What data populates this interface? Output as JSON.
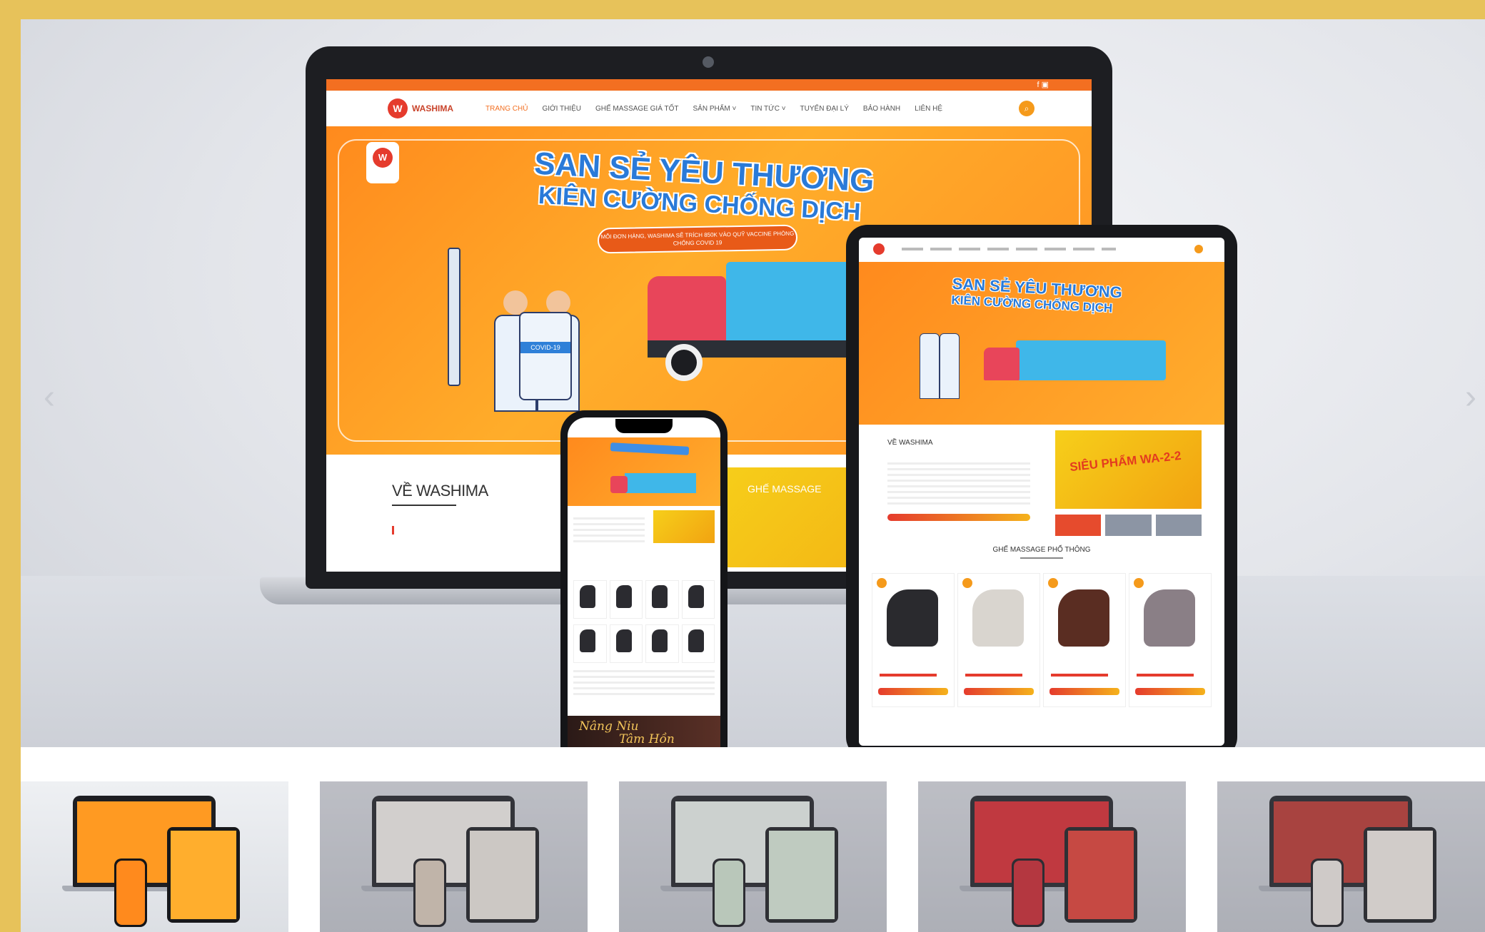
{
  "gallery": {
    "prev_icon": "‹",
    "next_icon": "›"
  },
  "laptop_site": {
    "logo_text": "WASHIMA",
    "logo_mark": "W",
    "social_icons": "f ▣",
    "nav": [
      "TRANG CHỦ",
      "GIỚI THIỆU",
      "GHẾ MASSAGE GIÁ TỐT",
      "SẢN PHẨM ˅",
      "TIN TỨC ˅",
      "TUYỂN ĐẠI LÝ",
      "BẢO HÀNH",
      "LIÊN HỆ"
    ],
    "search_icon": "⌕",
    "banner_title_1": "SAN SẺ YÊU THƯƠNG",
    "banner_title_2": "KIÊN CƯỜNG CHỐNG DỊCH",
    "banner_pill": "MỖI ĐƠN HÀNG, WASHIMA SẼ TRÍCH 850K VÀO QUỸ VACCINE PHÒNG CHỐNG COVID 19",
    "vaccine_label": "COVID-19",
    "about_title": "VỀ WASHIMA",
    "promo_label": "GHẾ MASSAGE"
  },
  "tablet_site": {
    "banner_title_1": "SAN SẺ YÊU THƯƠNG",
    "banner_title_2": "KIÊN CƯỜNG CHỐNG DỊCH",
    "about_title": "VỀ WASHIMA",
    "promo_text": "SIÊU PHẨM WA-2-2",
    "section_title": "GHẾ MASSAGE PHỔ THÔNG",
    "chair_colors": [
      "#2a2a2e",
      "#d9d5cf",
      "#5a2d22",
      "#8a7f86"
    ]
  },
  "phone_site": {
    "footer_script_1": "Nâng Niu",
    "footer_script_2": "Tâm Hồn"
  },
  "thumbnails": [
    {
      "name": "washima",
      "active": true,
      "laptop": "#ff9a22",
      "tablet": "#ffae2d",
      "phone": "#ff8a1d"
    },
    {
      "name": "beige",
      "active": false,
      "laptop": "#f1ede6",
      "tablet": "#e8e3da",
      "phone": "#d9c9b6"
    },
    {
      "name": "green",
      "active": false,
      "laptop": "#e8efe8",
      "tablet": "#d7e7d4",
      "phone": "#cfe2cc"
    },
    {
      "name": "red-tet",
      "active": false,
      "laptop": "#d8242a",
      "tablet": "#e03a2e",
      "phone": "#c9222a"
    },
    {
      "name": "food",
      "active": false,
      "laptop": "#b8322a",
      "tablet": "#efe8e0",
      "phone": "#ece6df"
    }
  ]
}
